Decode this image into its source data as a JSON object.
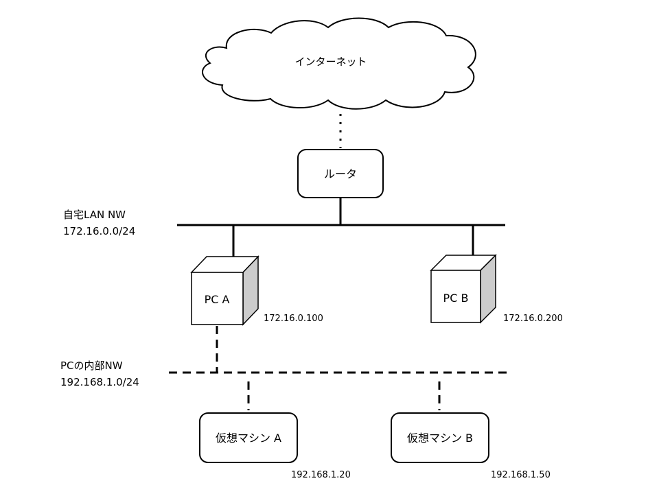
{
  "internet": {
    "label": "インターネット"
  },
  "router": {
    "label": "ルータ"
  },
  "home_lan": {
    "name": "自宅LAN NW",
    "cidr": "172.16.0.0/24"
  },
  "pc_internal": {
    "name": "PCの内部NW",
    "cidr": "192.168.1.0/24"
  },
  "pc_a": {
    "label": "PC A",
    "ip": "172.16.0.100"
  },
  "pc_b": {
    "label": "PC B",
    "ip": "172.16.0.200"
  },
  "vm_a": {
    "label": "仮想マシン A",
    "ip": "192.168.1.20"
  },
  "vm_b": {
    "label": "仮想マシン B",
    "ip": "192.168.1.50"
  },
  "colors": {
    "line": "#000000",
    "box_fill": "#ffffff",
    "box_side": "#cccccc"
  }
}
